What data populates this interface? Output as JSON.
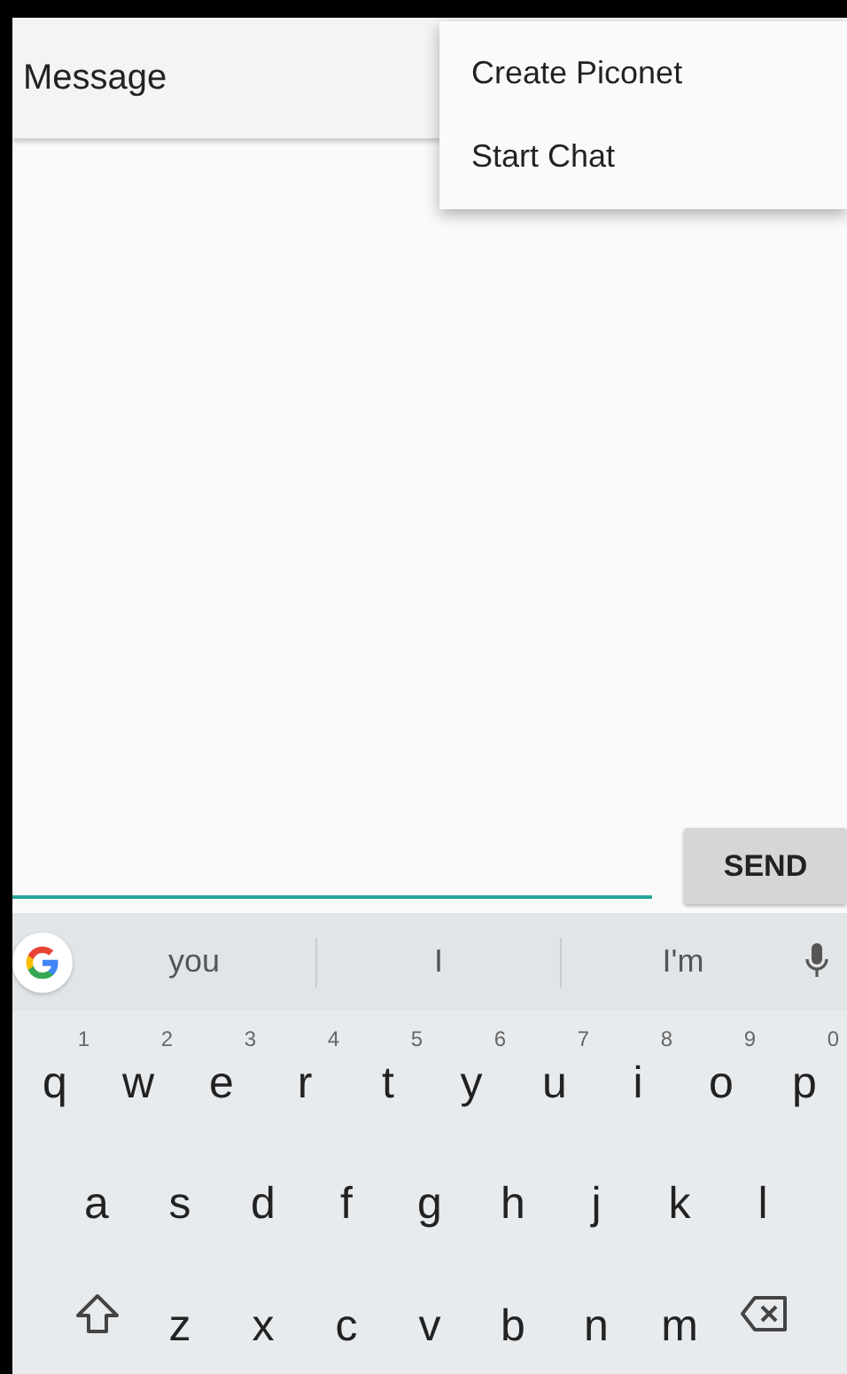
{
  "app_bar": {
    "title": "Message"
  },
  "overflow_menu": {
    "items": [
      {
        "label": "Create Piconet"
      },
      {
        "label": "Start Chat"
      }
    ]
  },
  "compose": {
    "send_button": "SEND"
  },
  "keyboard": {
    "suggestions": [
      "you",
      "I",
      "I'm"
    ],
    "rows": [
      [
        {
          "label": "q",
          "hint": "1"
        },
        {
          "label": "w",
          "hint": "2"
        },
        {
          "label": "e",
          "hint": "3"
        },
        {
          "label": "r",
          "hint": "4"
        },
        {
          "label": "t",
          "hint": "5"
        },
        {
          "label": "y",
          "hint": "6"
        },
        {
          "label": "u",
          "hint": "7"
        },
        {
          "label": "i",
          "hint": "8"
        },
        {
          "label": "o",
          "hint": "9"
        },
        {
          "label": "p",
          "hint": "0"
        }
      ],
      [
        {
          "label": "a"
        },
        {
          "label": "s"
        },
        {
          "label": "d"
        },
        {
          "label": "f"
        },
        {
          "label": "g"
        },
        {
          "label": "h"
        },
        {
          "label": "j"
        },
        {
          "label": "k"
        },
        {
          "label": "l"
        }
      ],
      [
        {
          "kind": "shift"
        },
        {
          "label": "z"
        },
        {
          "label": "x"
        },
        {
          "label": "c"
        },
        {
          "label": "v"
        },
        {
          "label": "b"
        },
        {
          "label": "n"
        },
        {
          "label": "m"
        },
        {
          "kind": "backspace"
        }
      ]
    ]
  }
}
